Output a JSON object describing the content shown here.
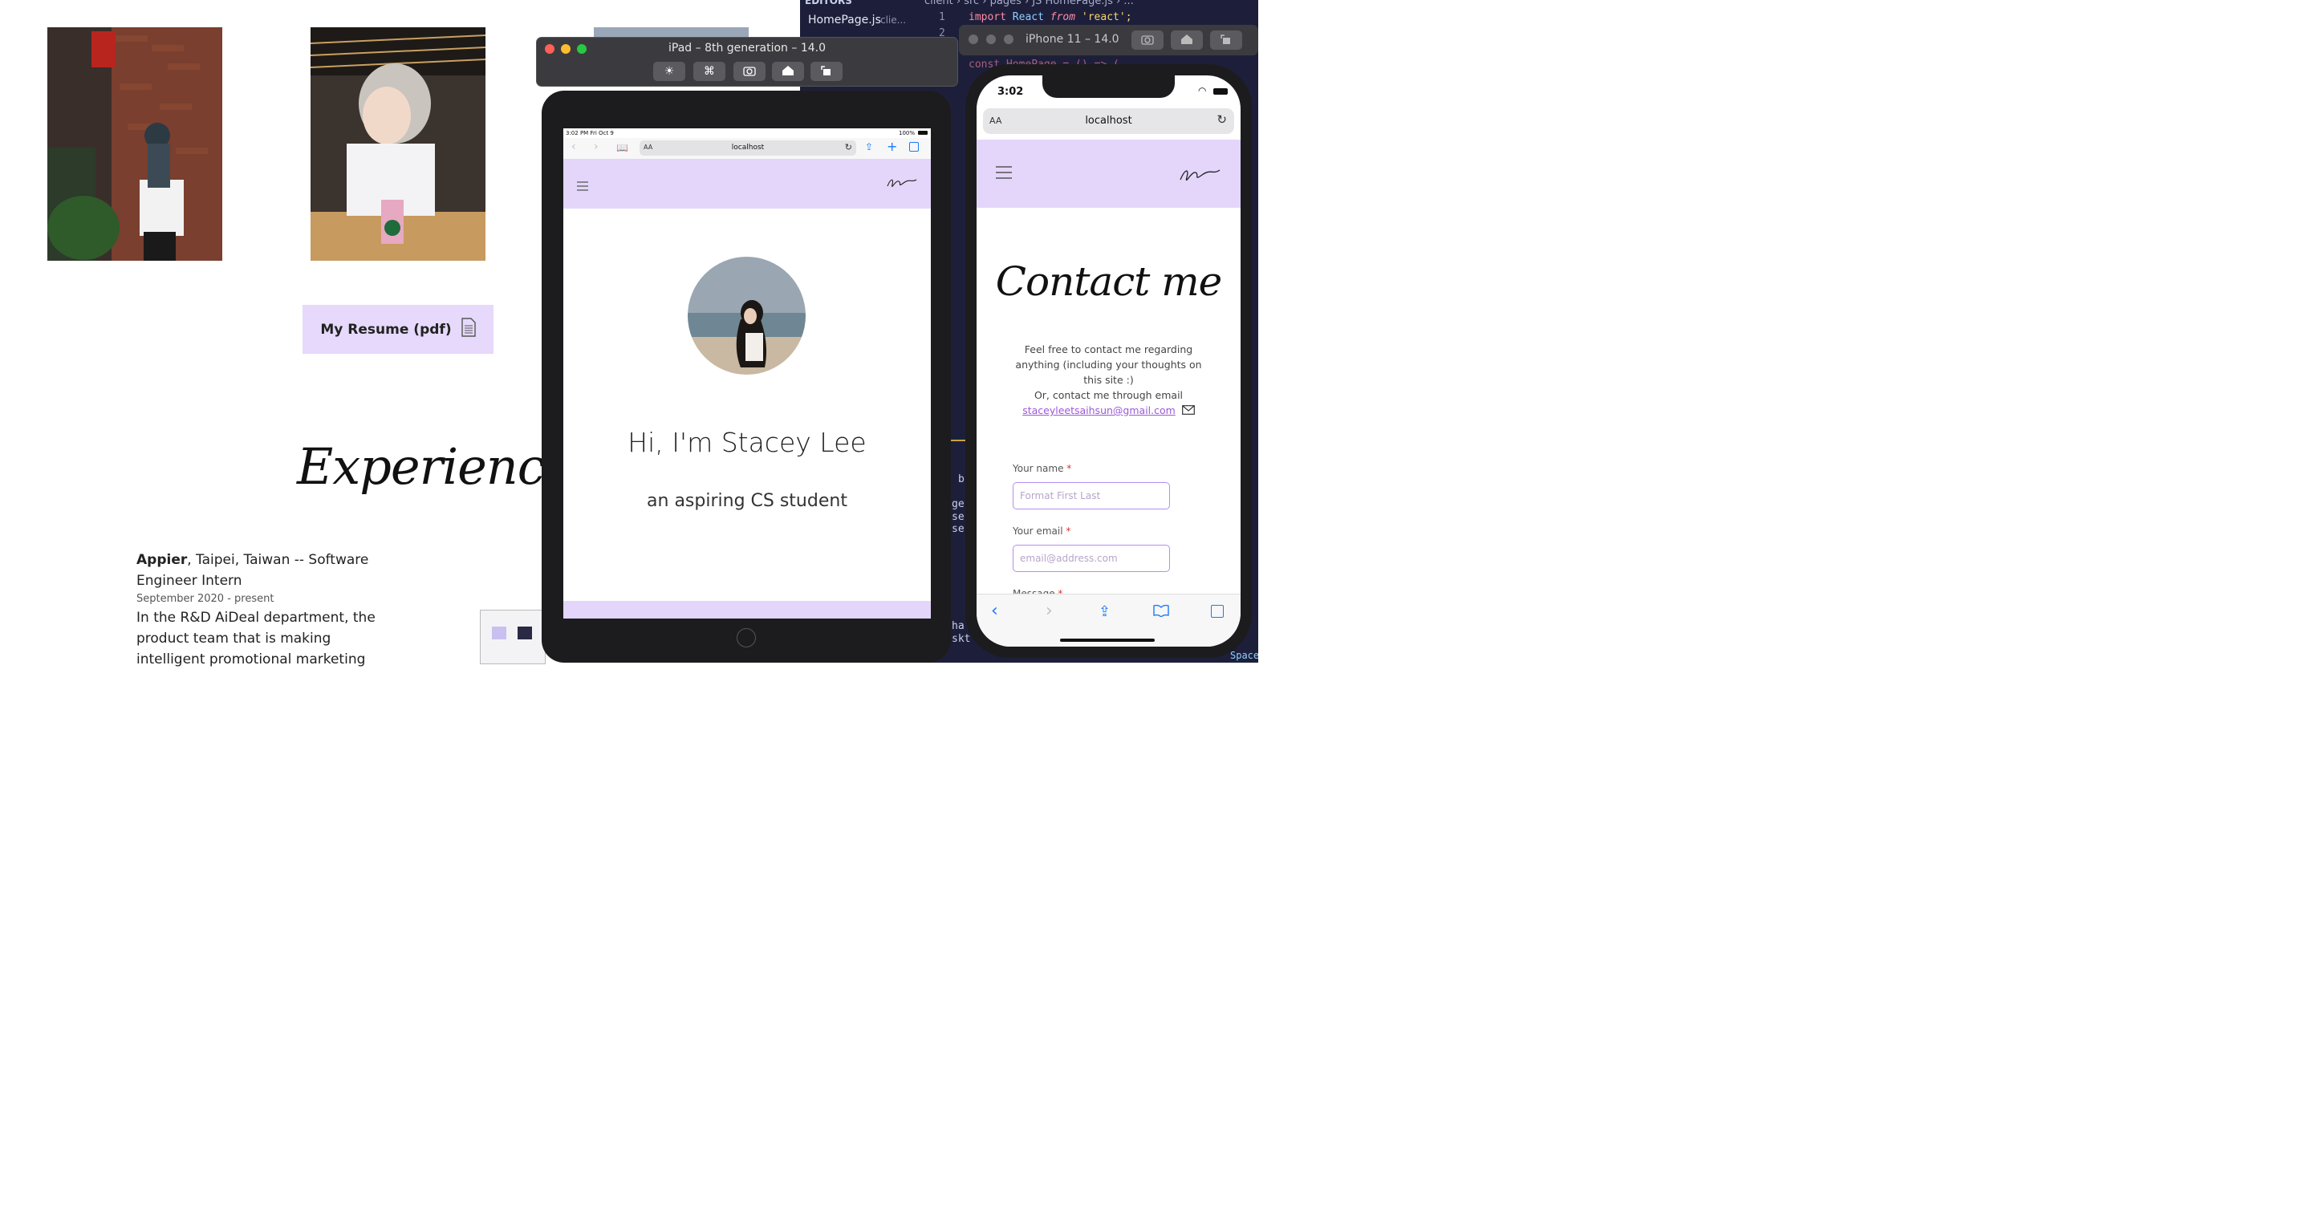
{
  "site": {
    "resume_label": "My Resume (pdf)",
    "experience_title": "Experience",
    "experience": {
      "company": "Appier",
      "location_role_line1": ", Taipei, Taiwan -- Software",
      "location_role_line2": "Engineer Intern",
      "dates": "September 2020 - present",
      "desc_line1": "In the R&D AiDeal department, the",
      "desc_line2": "product team that is making",
      "desc_line3": "intelligent promotional marketing"
    }
  },
  "editor": {
    "breadcrumb": "client › src › pages › JS HomePage.js › ...",
    "open_editors": "EDITORS",
    "file_tab": "HomePage.js",
    "file_tab_hint": "clie...",
    "line1_no": "1",
    "line2_no": "2",
    "line1_code_a": "import",
    "line1_code_b": "React",
    "line1_code_c": "from",
    "line1_code_d": "'react';",
    "line3_code": "const HomePage = () => (",
    "side_fragments": [
      "b",
      "ge",
      "se",
      "se",
      "ha",
      "skt"
    ],
    "status_right": "Space"
  },
  "ipad_window": {
    "title": "iPad – 8th generation – 14.0",
    "status_time": "3:02 PM   Fri Oct 9",
    "status_battery": "100%",
    "url": "localhost",
    "aa": "AA",
    "greeting": "Hi, I'm Stacey Lee",
    "subtitle": "an aspiring CS student"
  },
  "iphone_window": {
    "title": "iPhone 11 – 14.0",
    "time": "3:02",
    "aa": "AA",
    "url": "localhost",
    "contact_title": "Contact me",
    "intro_line1": "Feel free to contact me regarding",
    "intro_line2": "anything (including your thoughts on",
    "intro_line3": "this site :)",
    "intro_line4": "Or, contact me through email",
    "email": "staceyleetsaihsun@gmail.com",
    "name_label": "Your name",
    "name_placeholder": "Format First Last",
    "email_label": "Your email",
    "email_placeholder": "email@address.com",
    "message_label": "Message",
    "required_mark": "*"
  },
  "colors": {
    "lavender": "#e4d6fa",
    "accent_purple": "#9b59d6",
    "editor_bg": "#1d1f3a"
  }
}
